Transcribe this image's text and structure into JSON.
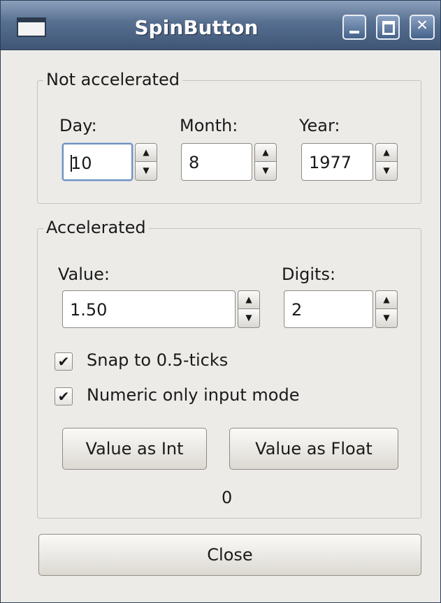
{
  "window": {
    "title": "SpinButton"
  },
  "not_accelerated": {
    "title": "Not accelerated",
    "day": {
      "label": "Day:",
      "value_before_caret": "",
      "value_after_caret": "10"
    },
    "month": {
      "label": "Month:",
      "value": "8"
    },
    "year": {
      "label": "Year:",
      "value": "1977"
    }
  },
  "accelerated": {
    "title": "Accelerated",
    "value": {
      "label": "Value:",
      "value": "1.50"
    },
    "digits": {
      "label": "Digits:",
      "value": "2"
    },
    "snap": {
      "label": "Snap to 0.5-ticks",
      "checked": true
    },
    "numeric": {
      "label": "Numeric only input mode",
      "checked": true
    },
    "int_button": "Value as Int",
    "float_button": "Value as Float",
    "result": "0"
  },
  "close_button": "Close",
  "glyphs": {
    "up": "▲",
    "down": "▼",
    "check": "✔"
  }
}
